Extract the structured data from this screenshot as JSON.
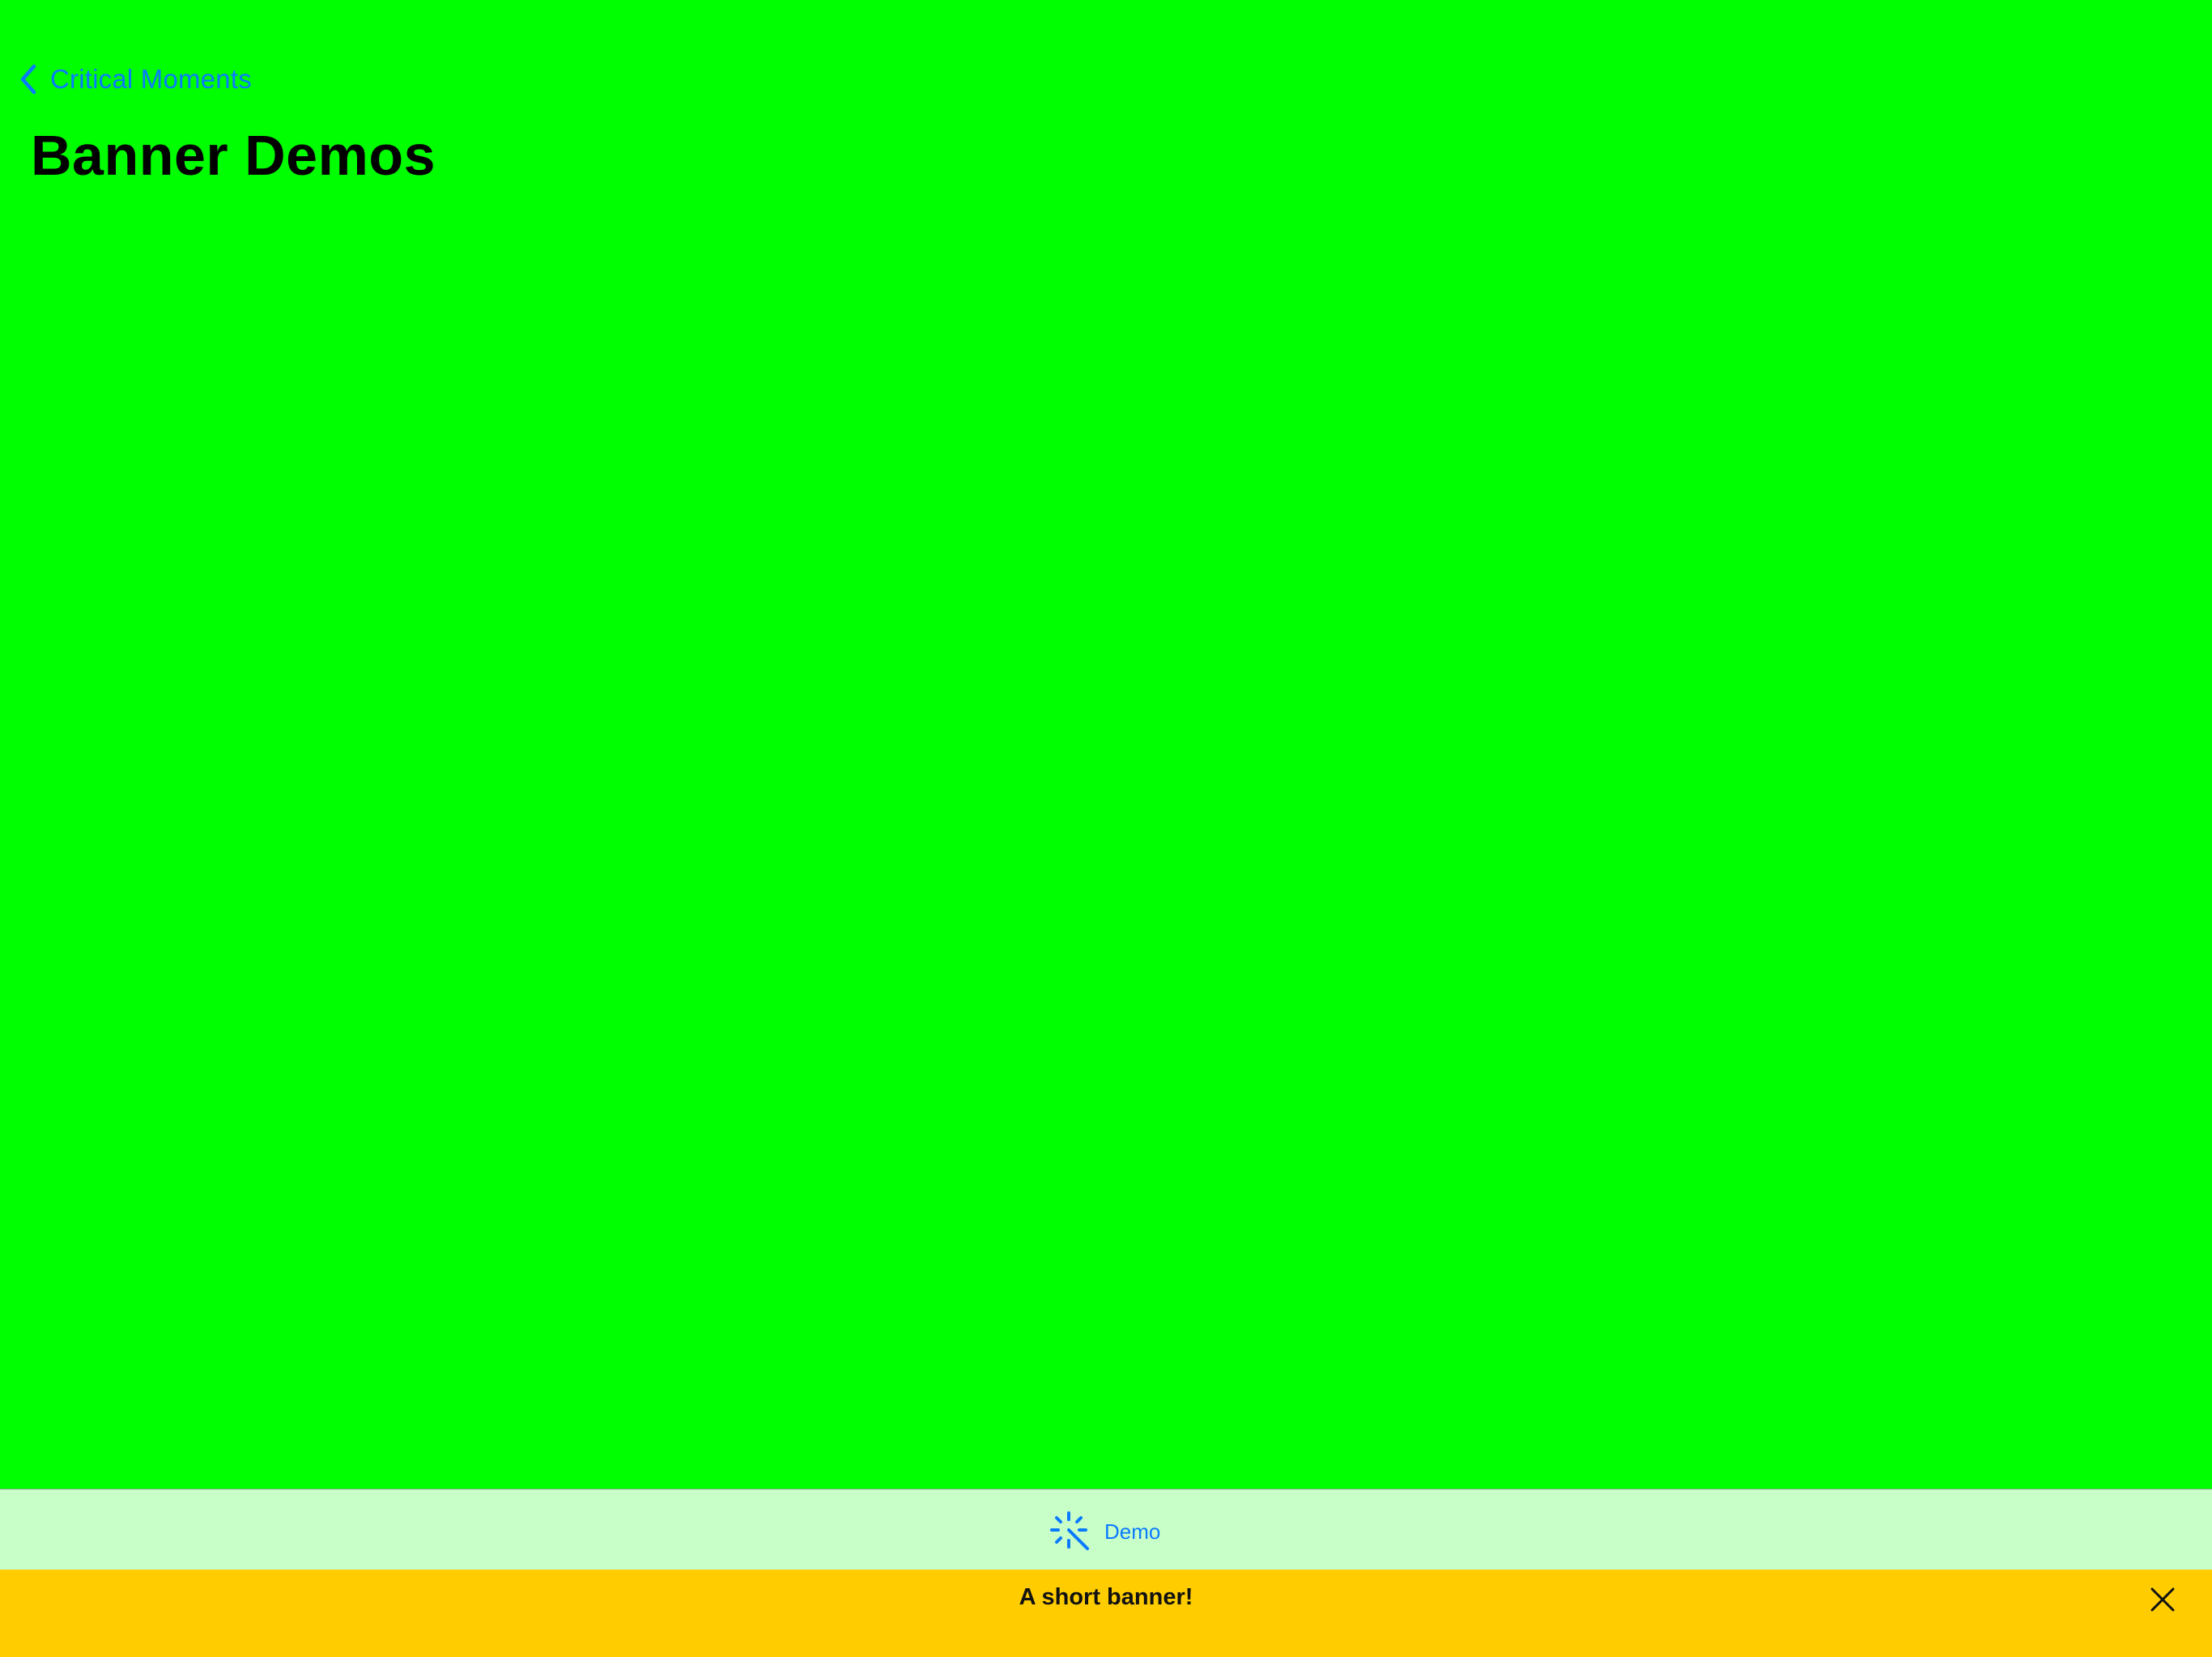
{
  "colors": {
    "background": "#00ff00",
    "accent": "#0a7aff",
    "tabbar_background": "#c8ffc8",
    "banner_background": "#ffcc00"
  },
  "navigation": {
    "back_icon": "chevron-left-icon",
    "back_label": "Critical Moments",
    "title": "Banner Demos"
  },
  "tabbar": {
    "items": [
      {
        "icon": "magic-wand-icon",
        "label": "Demo",
        "selected": true
      }
    ]
  },
  "banner": {
    "message": "A short banner!",
    "close_icon": "close-icon"
  }
}
